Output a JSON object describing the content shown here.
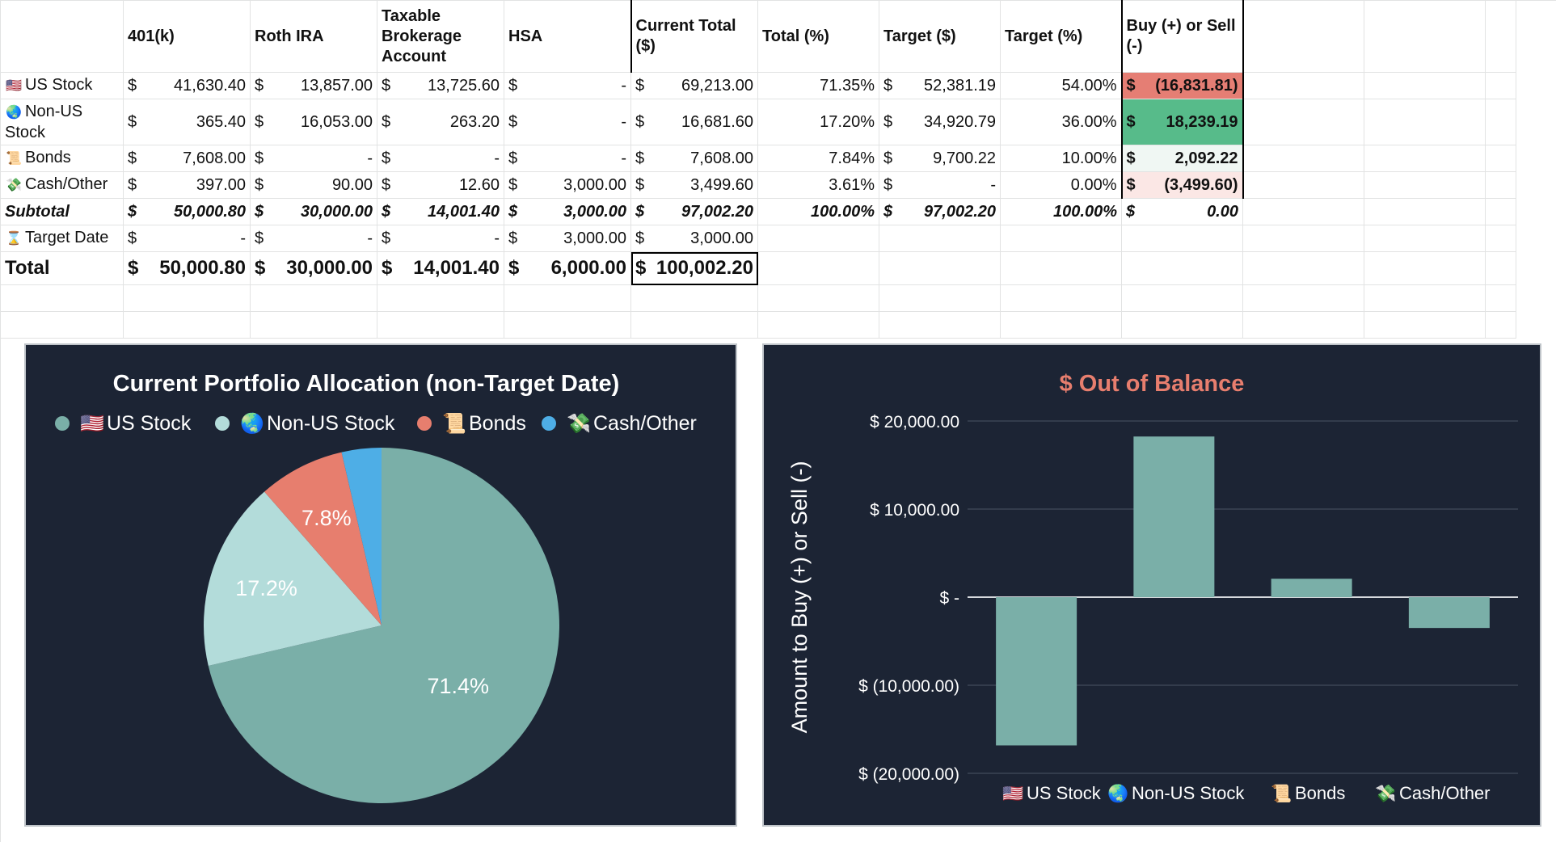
{
  "table": {
    "headers": [
      "",
      "401(k)",
      "Roth IRA",
      "Taxable Brokerage Account",
      "HSA",
      "Current Total ($)",
      "Total (%)",
      "Target ($)",
      "Target (%)",
      "Buy (+) or Sell (-)"
    ],
    "rows": [
      {
        "icon": "us-flag-icon",
        "label": "US Stock",
        "c401k": "41,630.40",
        "roth": "13,857.00",
        "taxable": "13,725.60",
        "hsa": "-",
        "current": "69,213.00",
        "total_pct": "71.35%",
        "target": "52,381.19",
        "target_pct": "54.00%",
        "buy_sell": "(16,831.81)"
      },
      {
        "icon": "globe-icon",
        "label": "Non-US Stock",
        "c401k": "365.40",
        "roth": "16,053.00",
        "taxable": "263.20",
        "hsa": "-",
        "current": "16,681.60",
        "total_pct": "17.20%",
        "target": "34,920.79",
        "target_pct": "36.00%",
        "buy_sell": "18,239.19"
      },
      {
        "icon": "scroll-icon",
        "label": "Bonds",
        "c401k": "7,608.00",
        "roth": "-",
        "taxable": "-",
        "hsa": "-",
        "current": "7,608.00",
        "total_pct": "7.84%",
        "target": "9,700.22",
        "target_pct": "10.00%",
        "buy_sell": "2,092.22"
      },
      {
        "icon": "money-wings-icon",
        "label": "Cash/Other",
        "c401k": "397.00",
        "roth": "90.00",
        "taxable": "12.60",
        "hsa": "3,000.00",
        "current": "3,499.60",
        "total_pct": "3.61%",
        "target": "-",
        "target_pct": "0.00%",
        "buy_sell": "(3,499.60)"
      }
    ],
    "subtotal": {
      "label": "Subtotal",
      "c401k": "50,000.80",
      "roth": "30,000.00",
      "taxable": "14,001.40",
      "hsa": "3,000.00",
      "current": "97,002.20",
      "total_pct": "100.00%",
      "target": "97,002.20",
      "target_pct": "100.00%",
      "buy_sell": "0.00"
    },
    "target_date": {
      "icon": "hourglass-icon",
      "label": "Target Date",
      "c401k": "-",
      "roth": "-",
      "taxable": "-",
      "hsa": "3,000.00",
      "current": "3,000.00"
    },
    "total": {
      "label": "Total",
      "c401k": "50,000.80",
      "roth": "30,000.00",
      "taxable": "14,001.40",
      "hsa": "6,000.00",
      "current": "100,002.20"
    },
    "currency_symbol": "$"
  },
  "chart_data": [
    {
      "type": "pie",
      "title": "Current Portfolio Allocation (non-Target Date)",
      "legend_position": "top",
      "categories": [
        "US Stock",
        "Non-US Stock",
        "Bonds",
        "Cash/Other"
      ],
      "legend_icons": [
        "us-flag-icon",
        "globe-icon",
        "scroll-icon",
        "money-wings-icon"
      ],
      "values": [
        71.35,
        17.2,
        7.84,
        3.61
      ],
      "data_labels": [
        "71.4%",
        "17.2%",
        "7.8%",
        ""
      ],
      "colors": [
        "#7aafa8",
        "#b3dcda",
        "#e77e6e",
        "#4eaee6"
      ],
      "background": "#1c2434"
    },
    {
      "type": "bar",
      "title": "$ Out of Balance",
      "title_color": "#e77e6e",
      "ylabel": "Amount to Buy (+) or Sell (-)",
      "xlabel": "",
      "categories": [
        "US Stock",
        "Non-US Stock",
        "Bonds",
        "Cash/Other"
      ],
      "category_icons": [
        "us-flag-icon",
        "globe-icon",
        "scroll-icon",
        "money-wings-icon"
      ],
      "values": [
        -16831.81,
        18239.19,
        2092.22,
        -3499.6
      ],
      "ylim": [
        -20000,
        20000
      ],
      "yticks": [
        20000,
        10000,
        0,
        -10000,
        -20000
      ],
      "ytick_labels": [
        "$ 20,000.00",
        "$ 10,000.00",
        "$ -",
        "$ (10,000.00)",
        "$ (20,000.00)"
      ],
      "grid": true,
      "legend_position": "bottom",
      "bar_color": "#7aafa8",
      "background": "#1c2434"
    }
  ]
}
